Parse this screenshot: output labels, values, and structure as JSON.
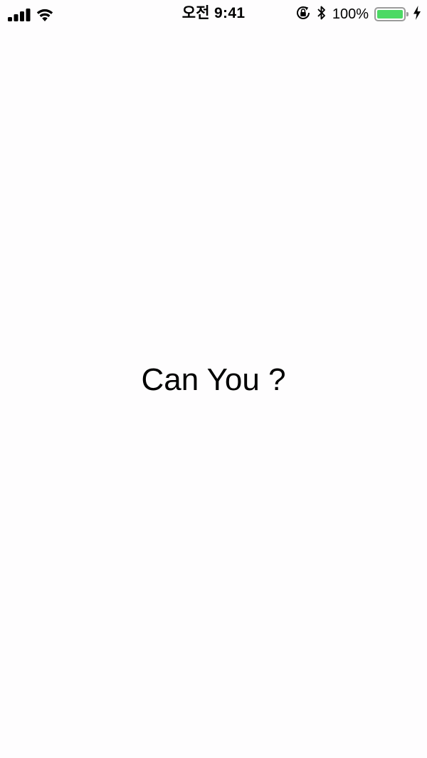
{
  "status_bar": {
    "time": "오전 9:41",
    "battery_percent": "100%",
    "battery_level": 1.0,
    "signal_bars": 4,
    "icons": [
      "cellular-signal-icon",
      "wifi-icon",
      "orientation-lock-icon",
      "bluetooth-icon",
      "battery-icon",
      "charging-bolt-icon"
    ],
    "battery_color": "#4cd964"
  },
  "main": {
    "text": "Can You ?"
  },
  "colors": {
    "background": "#fefdfe",
    "text": "#000000"
  }
}
